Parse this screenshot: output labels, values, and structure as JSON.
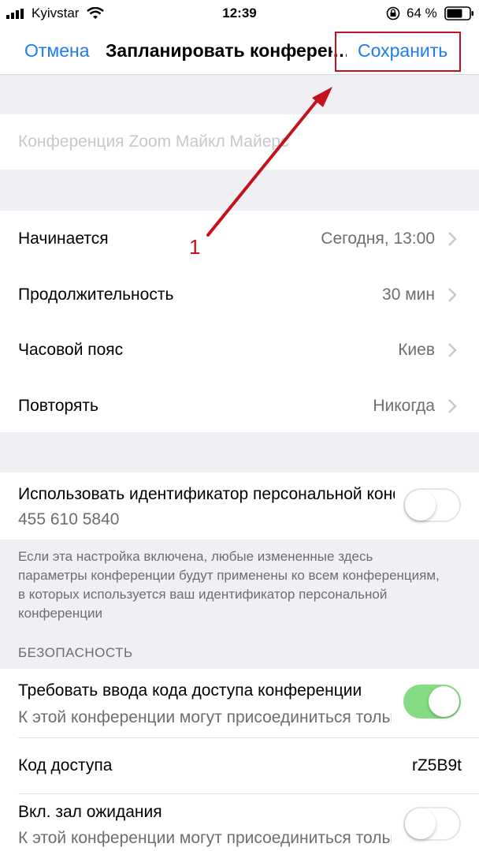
{
  "status_bar": {
    "carrier": "Kyivstar",
    "time": "12:39",
    "battery_percent": "64 %"
  },
  "nav": {
    "cancel_label": "Отмена",
    "title": "Запланировать конференцию",
    "save_label": "Сохранить"
  },
  "meeting": {
    "topic_placeholder": "Конференция Zoom Майкл Майерс"
  },
  "schedule": {
    "rows": [
      {
        "label": "Начинается",
        "value": "Сегодня, 13:00"
      },
      {
        "label": "Продолжительность",
        "value": "30 мин"
      },
      {
        "label": "Часовой пояс",
        "value": "Киев"
      },
      {
        "label": "Повторять",
        "value": "Никогда"
      }
    ]
  },
  "pmi": {
    "title": "Использовать идентификатор персональной конференции",
    "id": "455 610 5840",
    "enabled": false,
    "note": "Если эта настройка включена, любые измененные здесь параметры конференции будут применены ко всем конференциям, в которых используется ваш идентификатор персональной конференции"
  },
  "security": {
    "header": "БЕЗОПАСНОСТЬ",
    "passcode_required": {
      "title": "Требовать ввода кода доступа конференции",
      "subtitle": "К этой конференции могут присоединиться только пользователи с кодом доступа",
      "enabled": true
    },
    "passcode": {
      "label": "Код доступа",
      "value": "rZ5B9t"
    },
    "waiting_room": {
      "title": "Вкл. зал ожидания",
      "subtitle": "К этой конференции могут присоединиться только пользователи, допущенные организатором",
      "enabled": false
    }
  },
  "annotation": {
    "step_number": "1",
    "color": "#c4121d"
  },
  "colors": {
    "accent": "#1f7cf0",
    "toggle_on": "#85dc84",
    "background": "#efeff4"
  }
}
